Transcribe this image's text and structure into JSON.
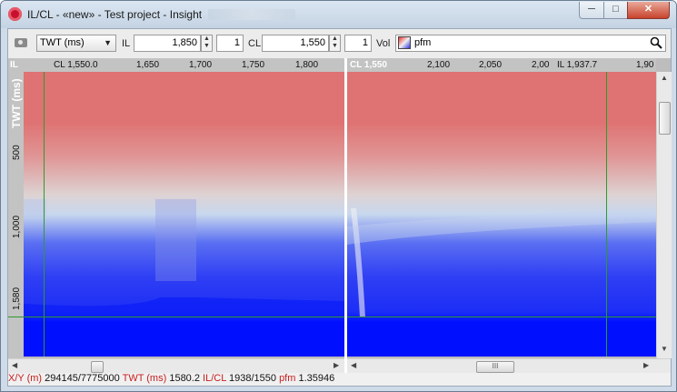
{
  "window": {
    "title": "IL/CL - «new» - Test project - Insight",
    "controls": {
      "minimize": "─",
      "maximize": "□",
      "close": "✕"
    }
  },
  "toolbar": {
    "domain_value": "TWT (ms)",
    "il_label": "IL",
    "il_value": "1,850",
    "il_step": "1",
    "cl_label": "CL",
    "cl_value": "1,550",
    "cl_step": "1",
    "vol_label": "Vol",
    "vol_value": "pfm"
  },
  "left_pane": {
    "corner_label": "IL",
    "cursor_label": "CL 1,550.0",
    "top_ticks": [
      "1,650",
      "1,700",
      "1,750",
      "1,800"
    ],
    "axis_title": "TWT (ms)",
    "left_ticks": [
      "500",
      "1,000",
      "1,580"
    ]
  },
  "right_pane": {
    "corner_label": "CL 1,550",
    "top_ticks": [
      "2,100",
      "2,050",
      "2,00"
    ],
    "cursor_label": "IL 1,937.7",
    "edge_tick": "1,90"
  },
  "colors": {
    "accent_green": "#2e9a2e",
    "seismic_red": "#df7373",
    "seismic_blue": "#0010ff",
    "status_key": "#c81e1e"
  },
  "statusbar": {
    "xy_label": "X/Y (m)",
    "xy_value": "294145/7775000",
    "twt_label": "TWT (ms)",
    "twt_value": "1580.2",
    "ilcl_label": "IL/CL",
    "ilcl_value": "1938/1550",
    "attr_label": "pfm",
    "attr_value": "1.35946"
  }
}
